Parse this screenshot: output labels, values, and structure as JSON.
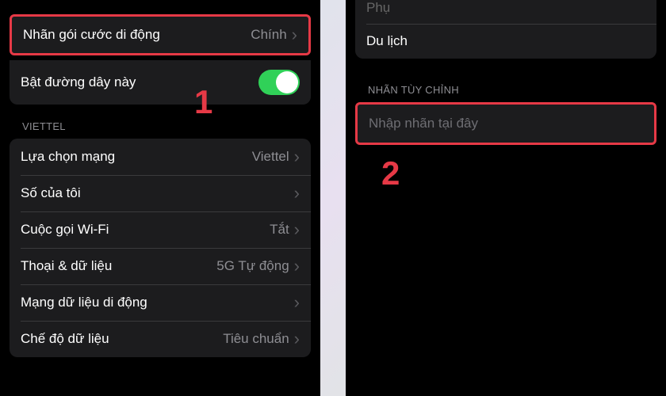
{
  "left": {
    "group1": {
      "plan_label": "Nhãn gói cước di động",
      "plan_value": "Chính",
      "line_toggle": "Bật đường dây này"
    },
    "section": "VIETTEL",
    "group2": [
      {
        "label": "Lựa chọn mạng",
        "value": "Viettel"
      },
      {
        "label": "Số của tôi",
        "value": ""
      },
      {
        "label": "Cuộc gọi Wi-Fi",
        "value": "Tắt"
      },
      {
        "label": "Thoại & dữ liệu",
        "value": "5G Tự động"
      },
      {
        "label": "Mạng dữ liệu di động",
        "value": ""
      },
      {
        "label": "Chế độ dữ liệu",
        "value": "Tiêu chuẩn"
      }
    ],
    "annotation": "1"
  },
  "right": {
    "top_item_partial": "Phụ",
    "row_travel": "Du lịch",
    "section": "NHÃN TÙY CHỈNH",
    "input_placeholder": "Nhập nhãn tại đây",
    "annotation": "2"
  },
  "colors": {
    "highlight": "#e63946",
    "toggle_on": "#30d158"
  }
}
